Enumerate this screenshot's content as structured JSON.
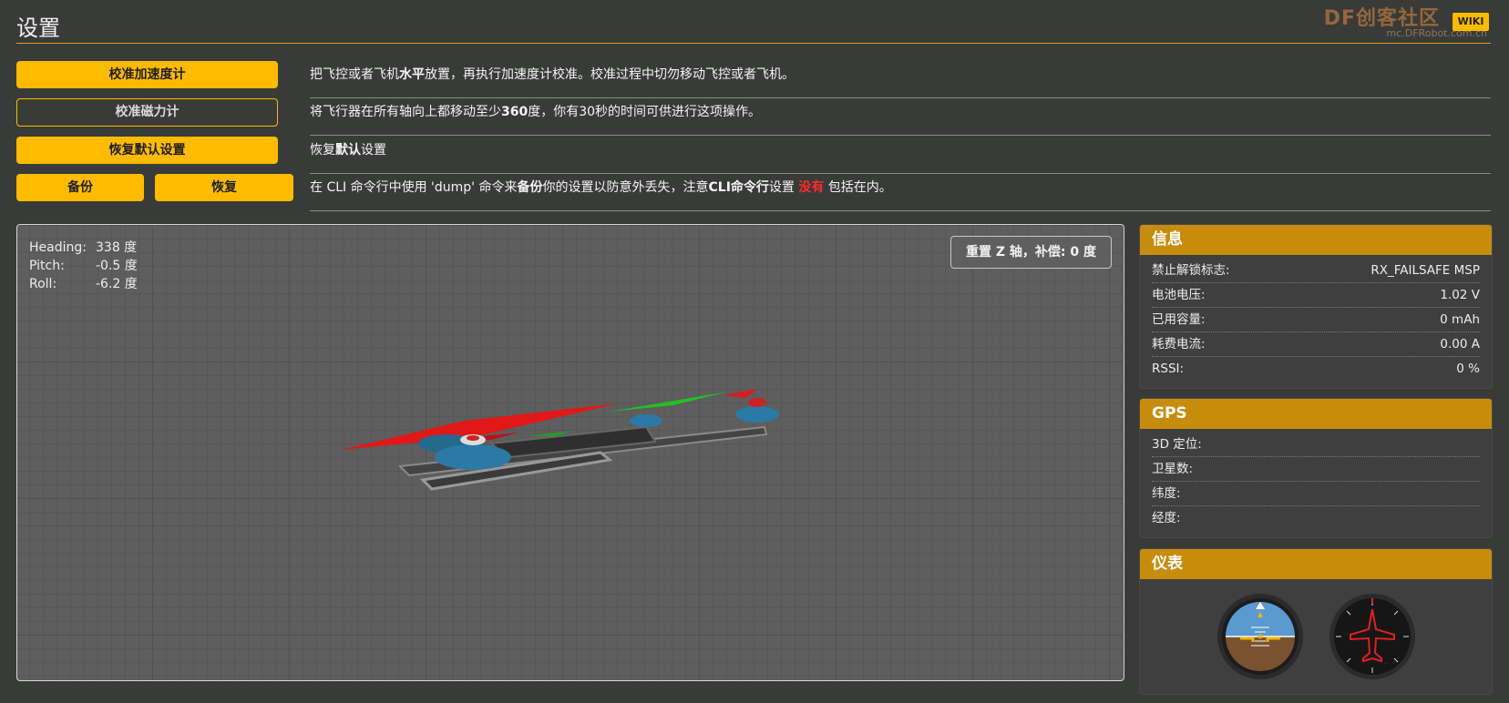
{
  "header": {
    "title": "设置",
    "wiki_label": "WIKI",
    "watermark": "DF创客社区",
    "watermark_sub": "mc.DFRobot.com.cn"
  },
  "actions": [
    {
      "buttons": [
        "校准加速度计"
      ],
      "description_html_parts": [
        "把飞控或者飞机",
        "水平",
        "放置，再执行加速度计校准。校准过程中切勿移动飞控或者飞机。"
      ]
    },
    {
      "buttons": [
        "校准磁力计"
      ],
      "description_html_parts": [
        "将飞行器在所有轴向上都移动至少",
        "360",
        "度，你有30秒的时间可供进行这项操作。"
      ]
    },
    {
      "buttons": [
        "恢复默认设置"
      ],
      "description_html_parts": [
        "恢复",
        "默认",
        "设置"
      ]
    },
    {
      "buttons": [
        "备份",
        "恢复"
      ],
      "description_html_parts": [
        "在 CLI 命令行中使用 'dump' 命令来",
        "备份",
        "你的设置以防意外丢失，注意",
        "CLI命令行",
        "设置 ",
        "没有",
        " 包括在内。"
      ]
    }
  ],
  "attitude": {
    "heading_label": "Heading:",
    "heading_value": "338 度",
    "pitch_label": "Pitch:",
    "pitch_value": "-0.5 度",
    "roll_label": "Roll:",
    "roll_value": "-6.2 度"
  },
  "reset_z_label": "重置 Z 轴，补偿: 0 度",
  "info": {
    "title": "信息",
    "rows": [
      {
        "label": "禁止解锁标志:",
        "value": "RX_FAILSAFE  MSP"
      },
      {
        "label": "电池电压:",
        "value": "1.02 V"
      },
      {
        "label": "已用容量:",
        "value": "0 mAh"
      },
      {
        "label": "耗费电流:",
        "value": "0.00 A"
      },
      {
        "label": "RSSI:",
        "value": "0 %"
      }
    ]
  },
  "gps": {
    "title": "GPS",
    "rows": [
      {
        "label": "3D 定位:",
        "value": ""
      },
      {
        "label": "卫星数:",
        "value": ""
      },
      {
        "label": "纬度:",
        "value": ""
      },
      {
        "label": "经度:",
        "value": ""
      }
    ]
  },
  "instruments": {
    "title": "仪表"
  },
  "colors": {
    "accent": "#ffbb00",
    "panel_header": "#c78c0b",
    "background": "#393b39",
    "warning_red": "#ff2b2b"
  }
}
